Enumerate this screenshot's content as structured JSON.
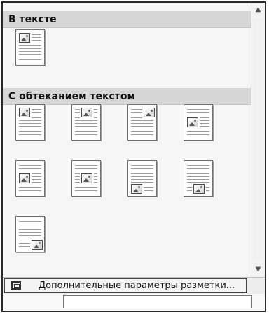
{
  "sections": {
    "inline": {
      "title": "В тексте"
    },
    "wrap": {
      "title": "С обтеканием текстом"
    }
  },
  "thumbnails": [
    {
      "name": "inline-position-thumbnail",
      "section": "inline",
      "image_pos": "top-left"
    },
    {
      "name": "wrap-top-left",
      "section": "wrap",
      "image_pos": "top-left"
    },
    {
      "name": "wrap-top-center",
      "section": "wrap",
      "image_pos": "top-center"
    },
    {
      "name": "wrap-top-right",
      "section": "wrap",
      "image_pos": "top-right"
    },
    {
      "name": "wrap-middle-left",
      "section": "wrap",
      "image_pos": "middle-left"
    },
    {
      "name": "wrap-middle-left-2",
      "section": "wrap",
      "image_pos": "middle-left"
    },
    {
      "name": "wrap-middle-center",
      "section": "wrap",
      "image_pos": "middle-center"
    },
    {
      "name": "wrap-bottom-left",
      "section": "wrap",
      "image_pos": "bottom-left"
    },
    {
      "name": "wrap-bottom-center",
      "section": "wrap",
      "image_pos": "bottom-center"
    },
    {
      "name": "wrap-bottom-right",
      "section": "wrap",
      "image_pos": "bottom-right"
    }
  ],
  "footer": {
    "more_options_label": "Дополнительные параметры разметки..."
  },
  "icons": {
    "scroll_up": "triangle-up",
    "scroll_down": "triangle-down",
    "layout_options": "layout-frame-icon"
  }
}
